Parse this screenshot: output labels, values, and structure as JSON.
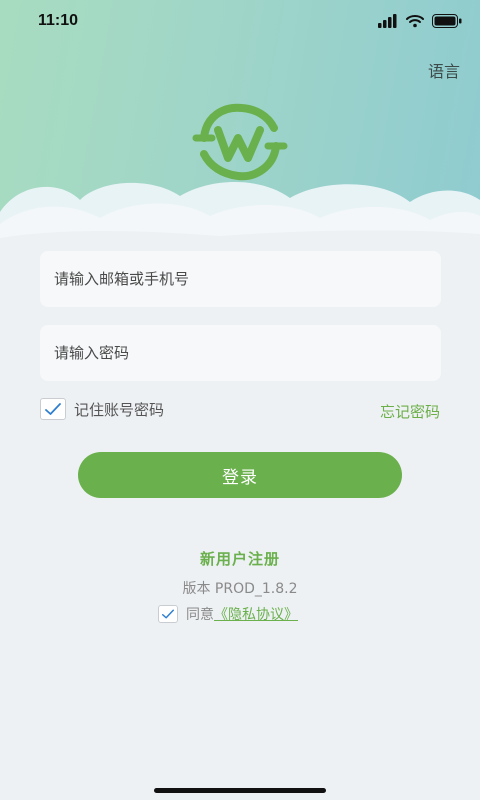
{
  "status": {
    "time": "11:10"
  },
  "header": {
    "language_label": "语言"
  },
  "form": {
    "account_placeholder": "请输入邮箱或手机号",
    "password_placeholder": "请输入密码",
    "remember_label": "记住账号密码",
    "remember_checked": true,
    "forgot_label": "忘记密码",
    "login_label": "登录"
  },
  "footer": {
    "register_label": "新用户注册",
    "version_text": "版本 PROD_1.8.2",
    "agree_prefix": "同意",
    "policy_label": "《隐私协议》",
    "agree_checked": true
  },
  "colors": {
    "accent": "#6ab04c",
    "hero_start": "#a8dcc0",
    "hero_end": "#8fcbd0",
    "background": "#eef1f4"
  },
  "icons": [
    "signal-icon",
    "wifi-icon",
    "battery-icon",
    "check-icon",
    "logo-w-icon"
  ]
}
